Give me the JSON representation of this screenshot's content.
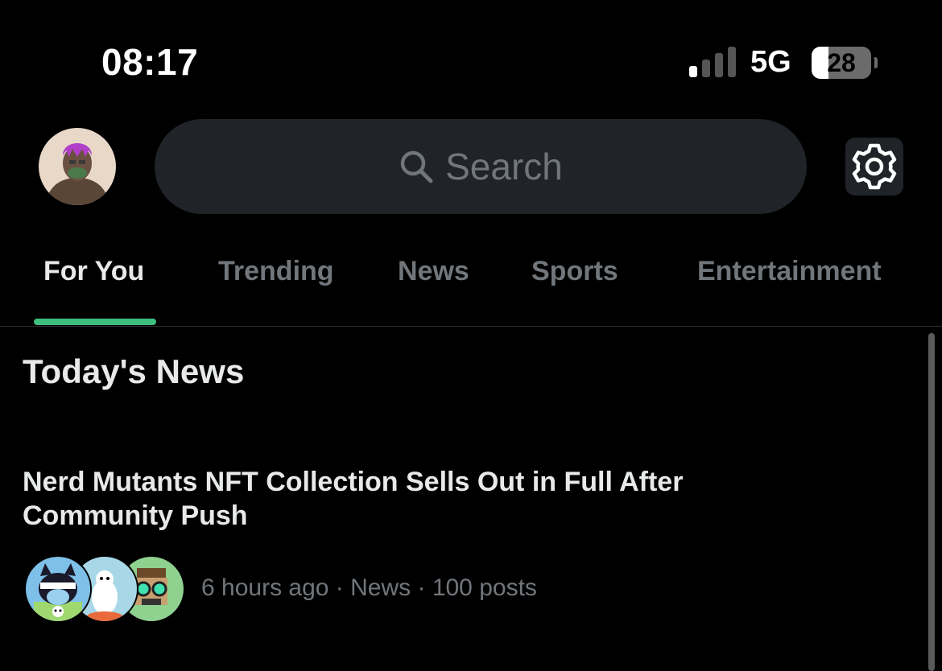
{
  "status_bar": {
    "time": "08:17",
    "network": "5G",
    "battery_level": "28",
    "battery_fraction": 0.28,
    "signal_bars_active": 1,
    "signal_bars_total": 4
  },
  "header": {
    "search_placeholder": "Search",
    "avatar_icon": "profile-avatar",
    "settings_icon": "gear-icon"
  },
  "tabs": [
    {
      "label": "For You",
      "active": true
    },
    {
      "label": "Trending",
      "active": false
    },
    {
      "label": "News",
      "active": false
    },
    {
      "label": "Sports",
      "active": false
    },
    {
      "label": "Entertainment",
      "active": false
    }
  ],
  "colors": {
    "accent": "#3fbf7f",
    "background": "#000000",
    "muted_text": "#71767b",
    "search_bg": "#202327"
  },
  "section": {
    "title": "Today's News"
  },
  "news_item": {
    "headline": "Nerd Mutants NFT Collection Sells Out in Full After Community Push",
    "time": "6 hours ago",
    "category": "News",
    "posts": "100 posts"
  }
}
